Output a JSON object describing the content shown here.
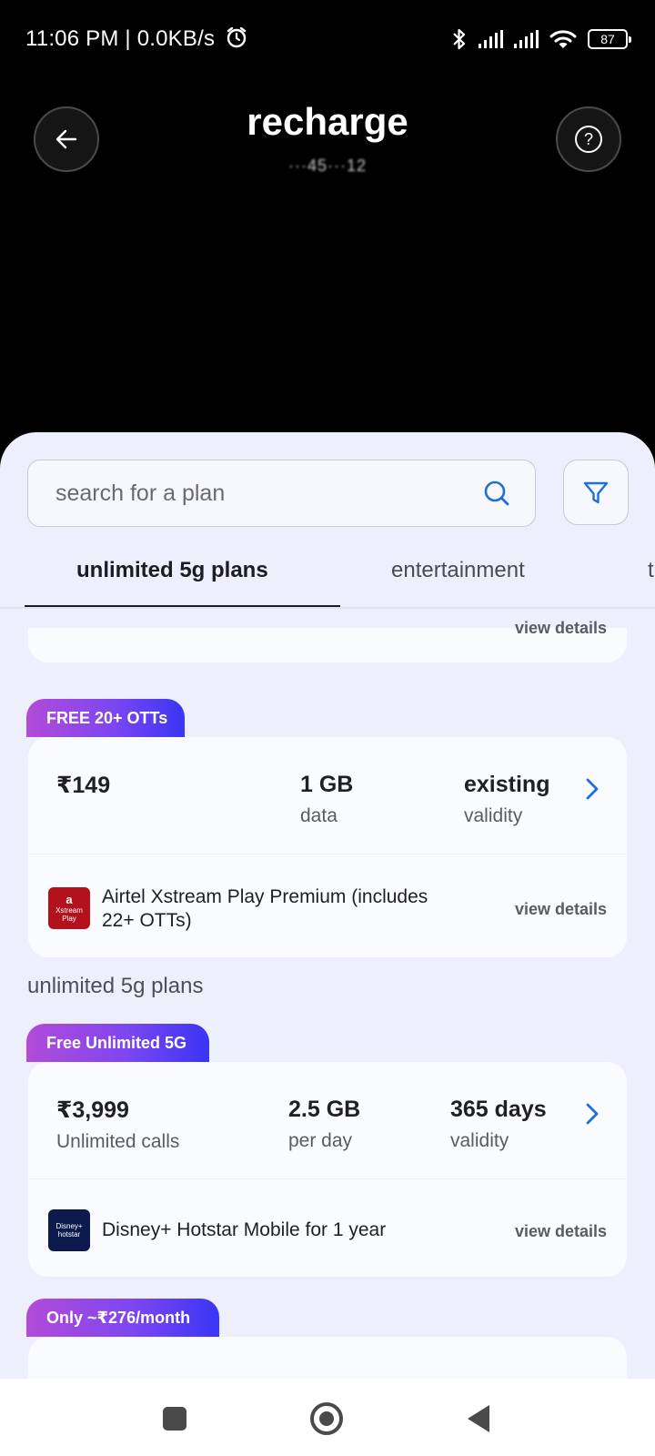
{
  "status_bar": {
    "time_speed": "11:06 PM | 0.0KB/s",
    "battery": "87"
  },
  "header": {
    "title": "recharge",
    "phone_number_blurred": "···45···12"
  },
  "search": {
    "placeholder": "search for a plan"
  },
  "tabs": [
    {
      "label": "unlimited 5g plans",
      "active": true
    },
    {
      "label": "entertainment",
      "active": false
    },
    {
      "label": "t",
      "active": false
    }
  ],
  "partial_card": {
    "link": "view details"
  },
  "plans": [
    {
      "badge": "FREE 20+ OTTs",
      "price": "₹149",
      "price_sub": "",
      "data_value": "1 GB",
      "data_label": "data",
      "validity_value": "existing",
      "validity_label": "validity",
      "benefit_logo_text": "Xstream Play",
      "benefit_line1": "Airtel Xstream Play Premium (includes",
      "benefit_line2": "22+ OTTs)",
      "view_details": "view details"
    },
    {
      "badge": "Free Unlimited 5G",
      "price": "₹3,999",
      "price_sub": "Unlimited calls",
      "data_value": "2.5 GB",
      "data_label": "per day",
      "validity_value": "365 days",
      "validity_label": "validity",
      "benefit_logo_text": "Disney+ hotstar",
      "benefit_line1": "Disney+ Hotstar Mobile for 1 year",
      "view_details": "view details"
    },
    {
      "badge": "Only ~₹276/month"
    }
  ],
  "section_title": "unlimited 5g plans",
  "colors": {
    "badge_gradient_start": "#b34bd8",
    "badge_gradient_end": "#3a35f5",
    "accent_blue": "#1f6fd6",
    "sheet_background": "#eeeffc"
  },
  "icons": [
    "back-arrow-icon",
    "help-icon",
    "search-icon",
    "filter-icon",
    "chevron-right-icon",
    "alarm-icon",
    "bluetooth-icon",
    "wifi-icon"
  ]
}
